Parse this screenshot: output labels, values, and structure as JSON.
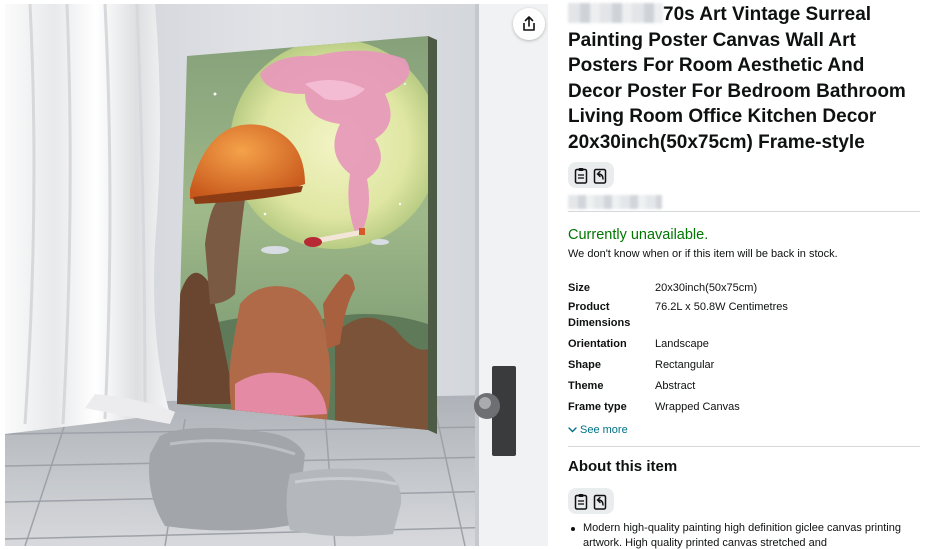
{
  "product": {
    "title_visible": "70s Art Vintage Surreal Painting Poster Canvas Wall Art Posters For Room Aesthetic And Decor Poster For Bedroom Bathroom Living Room Office Kitchen Decor 20x30inch(50x75cm) Frame-style"
  },
  "photo": {
    "alt": "Canvas wall art showing a surreal painting leaning against a wall",
    "share_icon": "share-icon"
  },
  "availability": {
    "status": "Currently unavailable.",
    "note": "We don't know when or if this item will be back in stock."
  },
  "specs": [
    {
      "key": "Size",
      "value": "20x30inch(50x75cm)"
    },
    {
      "key": "Product Dimensions",
      "value": "76.2L x 50.8W Centimetres"
    },
    {
      "key": "Orientation",
      "value": "Landscape"
    },
    {
      "key": "Shape",
      "value": "Rectangular"
    },
    {
      "key": "Theme",
      "value": "Abstract"
    },
    {
      "key": "Frame type",
      "value": "Wrapped Canvas"
    }
  ],
  "see_more": "See more",
  "about": {
    "title": "About this item",
    "bullets": [
      "Modern high-quality painting high definition giclee canvas printing artwork. High quality printed canvas stretched and"
    ]
  },
  "icons": {
    "copy": "clipboard-icon",
    "share_alt": "share-arrow-icon",
    "chevron": "chevron-down-icon"
  },
  "colors": {
    "availability": "#007600",
    "link": "#007185",
    "divider": "#d5d9d9"
  }
}
